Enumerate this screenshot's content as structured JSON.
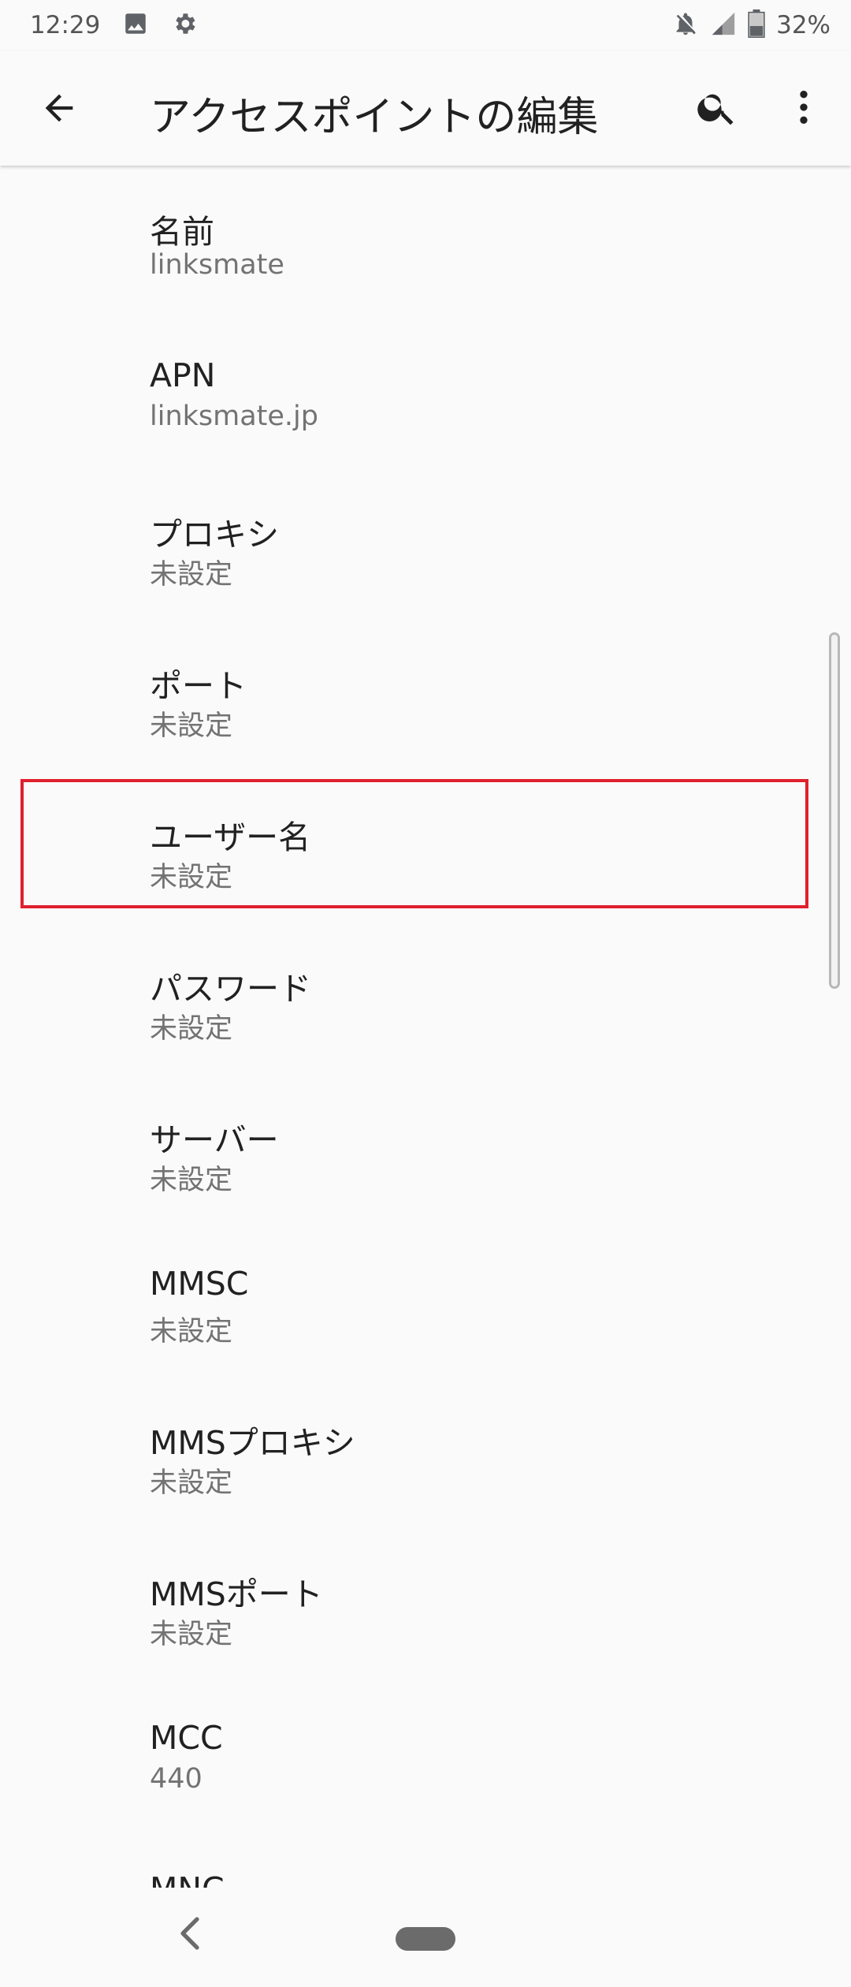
{
  "status_bar": {
    "time": "12:29",
    "battery_percent": "32%",
    "icons": [
      "image-icon",
      "gear-icon",
      "notifications-off-icon",
      "signal-icon",
      "battery-icon"
    ]
  },
  "app_bar": {
    "title": "アクセスポイントの編集",
    "icons": [
      "back-arrow-icon",
      "search-icon",
      "more-vert-icon"
    ]
  },
  "items": [
    {
      "title": "名前",
      "value": "linksmate"
    },
    {
      "title": "APN",
      "value": "linksmate.jp"
    },
    {
      "title": "プロキシ",
      "value": "未設定"
    },
    {
      "title": "ポート",
      "value": "未設定"
    },
    {
      "title": "ユーザー名",
      "value": "未設定"
    },
    {
      "title": "パスワード",
      "value": "未設定"
    },
    {
      "title": "サーバー",
      "value": "未設定"
    },
    {
      "title": "MMSC",
      "value": "未設定"
    },
    {
      "title": "MMSプロキシ",
      "value": "未設定"
    },
    {
      "title": "MMSポート",
      "value": "未設定"
    },
    {
      "title": "MCC",
      "value": "440"
    },
    {
      "title": "MNC",
      "value": ""
    }
  ],
  "highlight": {
    "color": "#e0202e",
    "item": "ユーザー名"
  },
  "nav_bar": {
    "icons": [
      "nav-back-icon",
      "home-pill-icon"
    ]
  }
}
